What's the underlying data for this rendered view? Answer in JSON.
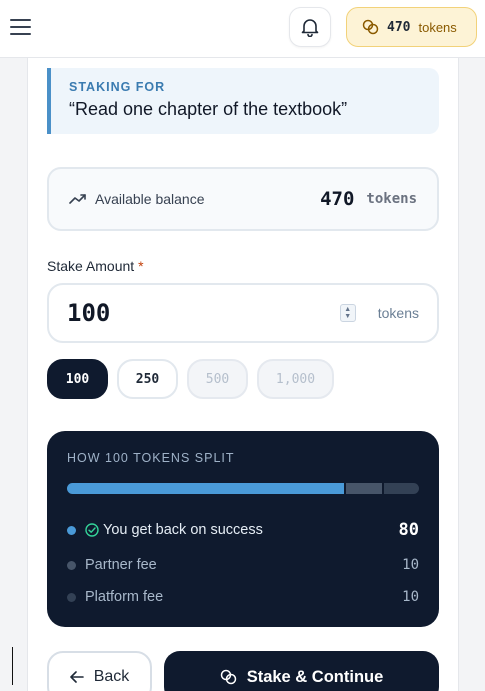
{
  "header": {
    "token_count": "470",
    "token_unit": "tokens",
    "icons": [
      "menu-icon",
      "bell-icon",
      "coins-icon"
    ]
  },
  "staking_for": {
    "label": "STAKING FOR",
    "title": "“Read one chapter of the textbook”"
  },
  "balance": {
    "label": "Available balance",
    "value": "470",
    "unit": "tokens"
  },
  "stake": {
    "label": "Stake Amount",
    "required_mark": "*",
    "value": "100",
    "unit": "tokens"
  },
  "presets": [
    {
      "label": "100",
      "state": "active"
    },
    {
      "label": "250",
      "state": "enabled"
    },
    {
      "label": "500",
      "state": "disabled"
    },
    {
      "label": "1,000",
      "state": "disabled"
    }
  ],
  "split": {
    "title": "HOW 100 TOKENS SPLIT",
    "rows": [
      {
        "label": "You get back on success",
        "value": "80",
        "color": "#4a9ad8"
      },
      {
        "label": "Partner fee",
        "value": "10",
        "color": "#475569"
      },
      {
        "label": "Platform fee",
        "value": "10",
        "color": "#334155"
      }
    ]
  },
  "actions": {
    "back_label": "Back",
    "continue_label": "Stake & Continue"
  },
  "colors": {
    "accent_blue": "#4a90c8",
    "dark_navy": "#0f1a2e",
    "gold_chip": "#fdf3d6"
  }
}
